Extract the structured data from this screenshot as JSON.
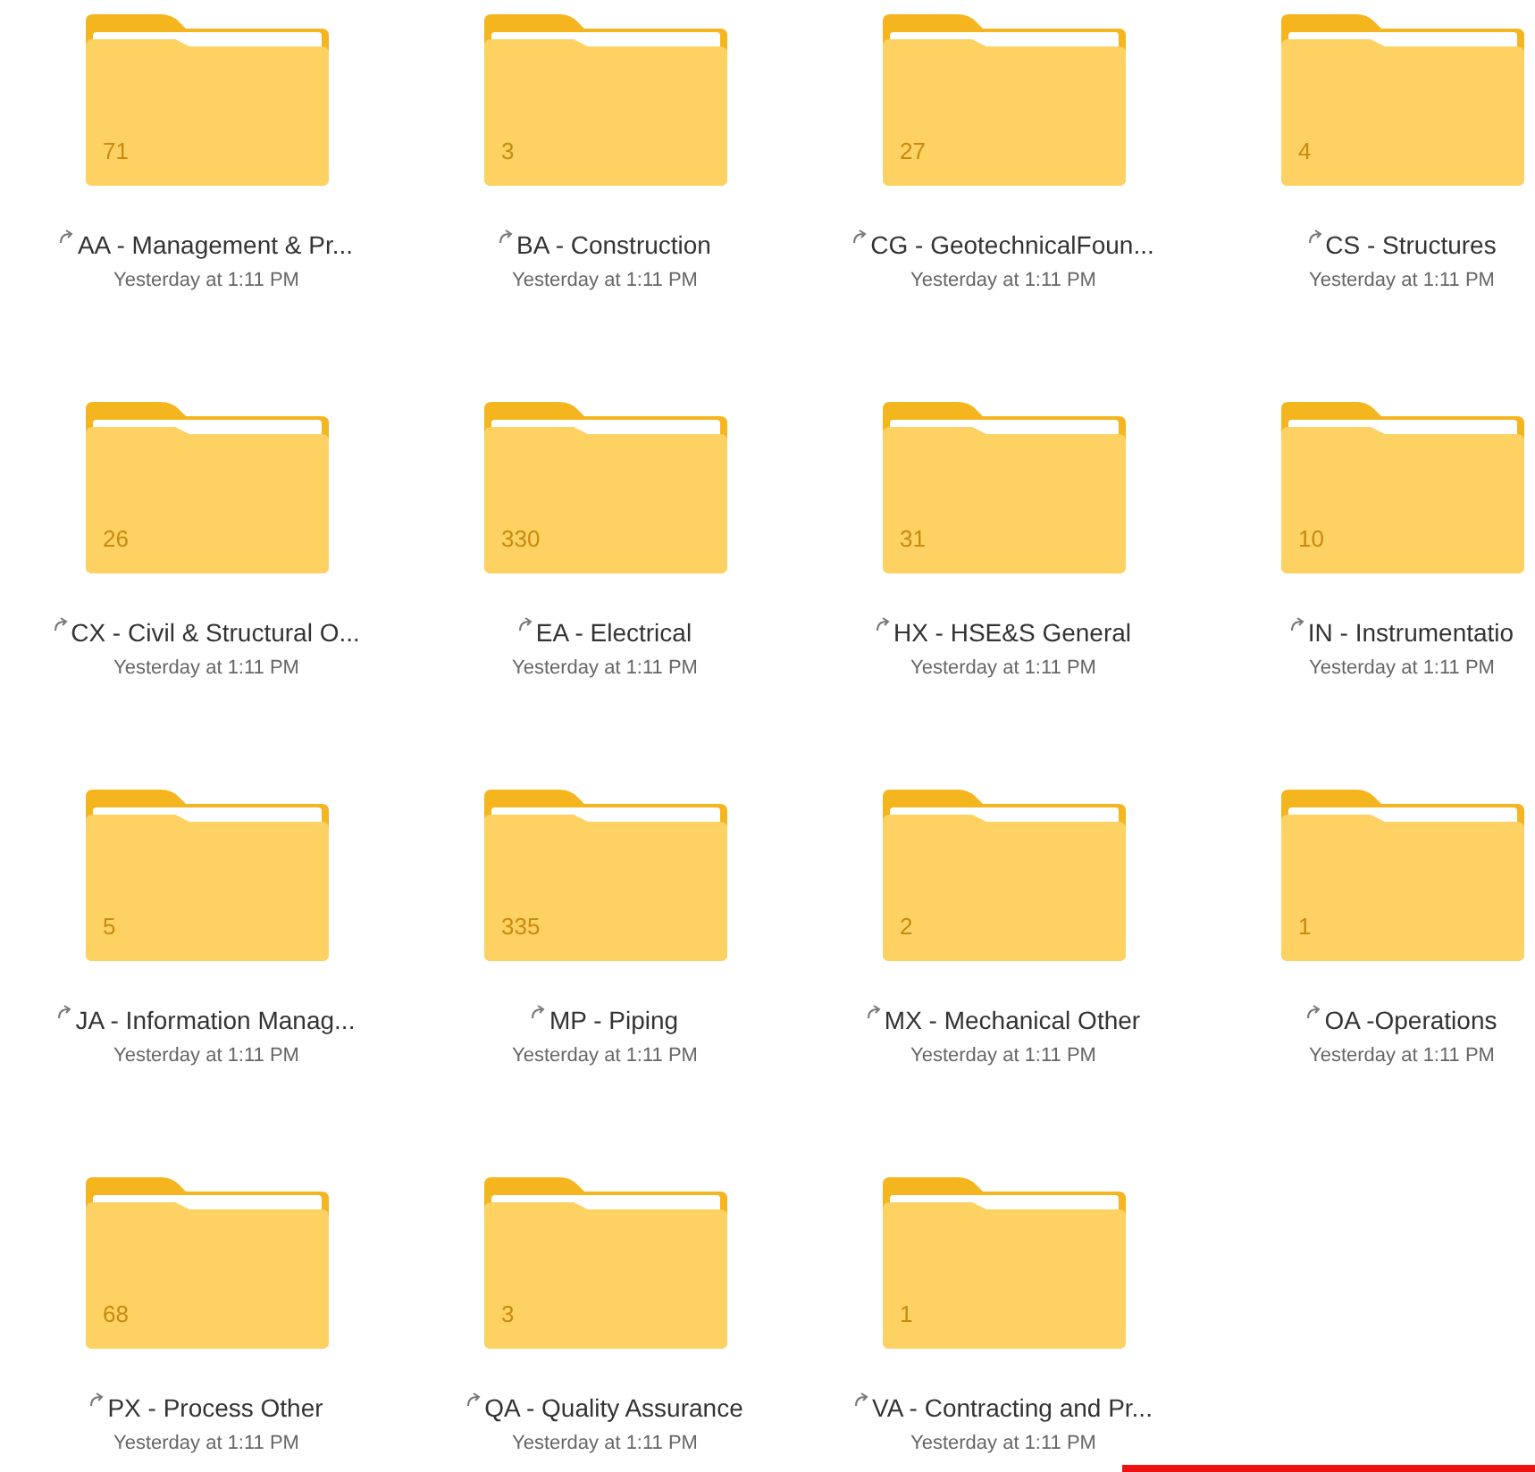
{
  "folders": [
    {
      "count": "71",
      "name": "AA - Management & Pr...",
      "modified": "Yesterday at 1:11 PM"
    },
    {
      "count": "3",
      "name": "BA - Construction",
      "modified": "Yesterday at 1:11 PM"
    },
    {
      "count": "27",
      "name": "CG - GeotechnicalFoun...",
      "modified": "Yesterday at 1:11 PM"
    },
    {
      "count": "4",
      "name": "CS - Structures",
      "modified": "Yesterday at 1:11 PM"
    },
    {
      "count": "26",
      "name": "CX - Civil & Structural O...",
      "modified": "Yesterday at 1:11 PM"
    },
    {
      "count": "330",
      "name": "EA - Electrical",
      "modified": "Yesterday at 1:11 PM"
    },
    {
      "count": "31",
      "name": "HX - HSE&S General",
      "modified": "Yesterday at 1:11 PM"
    },
    {
      "count": "10",
      "name": "IN - Instrumentatio",
      "modified": "Yesterday at 1:11 PM"
    },
    {
      "count": "5",
      "name": "JA - Information Manag...",
      "modified": "Yesterday at 1:11 PM"
    },
    {
      "count": "335",
      "name": "MP - Piping",
      "modified": "Yesterday at 1:11 PM"
    },
    {
      "count": "2",
      "name": "MX - Mechanical Other",
      "modified": "Yesterday at 1:11 PM"
    },
    {
      "count": "1",
      "name": "OA -Operations",
      "modified": "Yesterday at 1:11 PM"
    },
    {
      "count": "68",
      "name": "PX - Process Other",
      "modified": "Yesterday at 1:11 PM"
    },
    {
      "count": "3",
      "name": "QA - Quality Assurance",
      "modified": "Yesterday at 1:11 PM"
    },
    {
      "count": "1",
      "name": "VA - Contracting and Pr...",
      "modified": "Yesterday at 1:11 PM"
    }
  ]
}
